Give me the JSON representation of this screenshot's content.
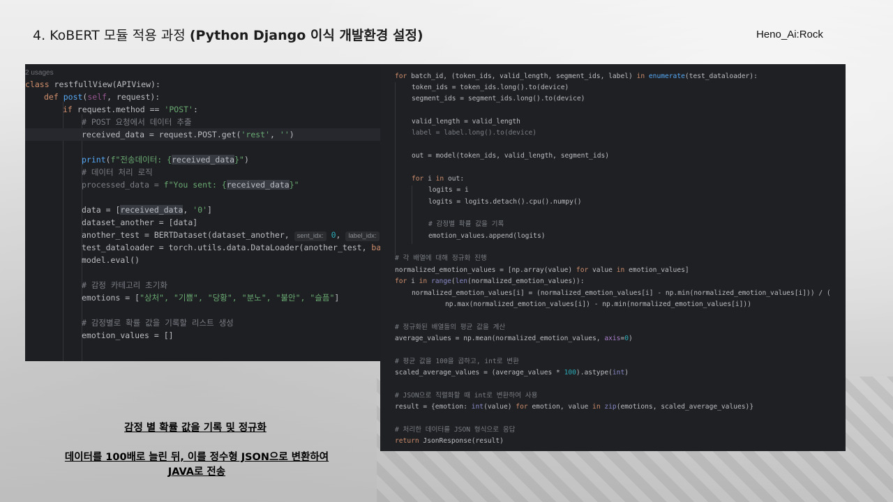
{
  "slide": {
    "title_prefix": "4. KoBERT 모듈 적용 과정 ",
    "title_bold": "(Python Django 이식 개발환경 설정)",
    "author": "Heno_Ai:Rock"
  },
  "left_code": {
    "usages": "2 usages",
    "l1_kw": "class",
    "l1_rest": " restfullView(APIView):",
    "l2_kw": "def",
    "l2_fn": "post",
    "l2_open": "(",
    "l2_self": "self",
    "l2_rest": ", request):",
    "l3_kw": "if",
    "l3_mid": " request.method == ",
    "l3_str": "'POST'",
    "l3_end": ":",
    "l4_cmt": "# POST 요청에서 데이터 추출",
    "l5_pre": "received_data = request.POST.get(",
    "l5_str1": "'rest'",
    "l5_mid": ", ",
    "l5_str2": "''",
    "l5_end": ")",
    "l7_fn": "print",
    "l7_open": "(",
    "l7_str1": "f\"전송데이터: {",
    "l7_var": "received_data",
    "l7_str2": "}\"",
    "l7_end": ")",
    "l8_cmt": "# 데이터 처리 로직",
    "l9_pre": "processed_data = ",
    "l9_str1": "f\"You sent: {",
    "l9_var": "received_data",
    "l9_str2": "}\"",
    "l11_pre": "data = [",
    "l11_var": "received_data",
    "l11_mid": ", ",
    "l11_str": "'0'",
    "l11_end": "]",
    "l12": "dataset_another = [data]",
    "l13_pre": "another_test = BERTDataset(dataset_another, ",
    "l13_hint1": "sent_idx:",
    "l13_num": " 0",
    "l13_mid": ", ",
    "l13_hint2": "label_idx:",
    "l14_pre": "test_dataloader = torch.utils.data.DataLoader(another_test, ",
    "l14_param": "bat",
    "l15": "model.eval()",
    "l17_cmt": "# 감정 카테고리 초기화",
    "l18_pre": "emotions = [",
    "l18_items": "\"상처\", \"기쁨\", \"당황\", \"분노\", \"불안\", \"슬픔\"",
    "l18_end": "]",
    "l20_cmt": "# 감정별로 확률 값을 기록할 리스트 생성",
    "l21": "emotion_values = []"
  },
  "right_code": {
    "r1_kw": "for",
    "r1_a": " batch_id, (token_ids, valid_length, segment_ids, label) ",
    "r1_kw2": "in",
    "r1_fn": " enumerate",
    "r1_b": "(test_dataloader):",
    "r2": "token_ids = token_ids.long().to(device)",
    "r3": "segment_ids = segment_ids.long().to(device)",
    "r5": "valid_length = valid_length",
    "r6": "label = label.long().to(device)",
    "r8": "out = model(token_ids, valid_length, segment_ids)",
    "r10_kw": "for",
    "r10_a": " i ",
    "r10_kw2": "in",
    "r10_b": " out:",
    "r11": "logits = i",
    "r12": "logits = logits.detach().cpu().numpy()",
    "r14_cmt": "# 감정별 확률 값을 기록",
    "r15": "emotion_values.append(logits)",
    "r17_cmt": "# 각 배열에 대해 정규화 진행",
    "r18_a": "normalized_emotion_values = [np.array(value) ",
    "r18_kw": "for",
    "r18_b": " value ",
    "r18_kw2": "in",
    "r18_c": " emotion_values]",
    "r19_kw": "for",
    "r19_a": " i ",
    "r19_kw2": "in",
    "r19_b1": " range",
    "r19_b2": "(",
    "r19_b3": "len",
    "r19_b4": "(normalized_emotion_values)):",
    "r20": "normalized_emotion_values[i] = (normalized_emotion_values[i] - np.min(normalized_emotion_values[i])) / (",
    "r21": "np.max(normalized_emotion_values[i]) - np.min(normalized_emotion_values[i]))",
    "r23_cmt": "# 정규화된 배열들의 평균 값을 계산",
    "r24_a": "average_values = np.mean(normalized_emotion_values, ",
    "r24_param": "axis",
    "r24_eq": "=",
    "r24_num": "0",
    "r24_end": ")",
    "r26_cmt": "# 평균 값을 100을 곱하고, int로 변환",
    "r27_a": "scaled_average_values = (average_values * ",
    "r27_num": "100",
    "r27_b": ").astype(",
    "r27_builtin": "int",
    "r27_end": ")",
    "r29_cmt": "# JSON으로 직렬화할 때 int로 변환하여 사용",
    "r30_a": "result = {emotion: ",
    "r30_builtin": "int",
    "r30_b": "(value) ",
    "r30_kw": "for",
    "r30_c": " emotion, value ",
    "r30_kw2": "in",
    "r30_builtin2": " zip",
    "r30_d": "(emotions, scaled_average_values)}",
    "r32_cmt": "# 처리한 데이터를 JSON 형식으로 응답",
    "r33_kw": "return",
    "r33_a": " JsonResponse(result)"
  },
  "notes": {
    "note1": "감정 별 확률 값을 기록 및 정규화",
    "note2_line1": "데이터를 100배로 늘린 뒤, 이를 정수형 JSON으로 변환하여",
    "note2_line2": "JAVA로 전송"
  },
  "colors": {
    "editor_bg": "#1e1f22",
    "keyword": "#cf8e6d",
    "string": "#6aab73",
    "comment": "#7a7e85",
    "function": "#56a8f5"
  }
}
